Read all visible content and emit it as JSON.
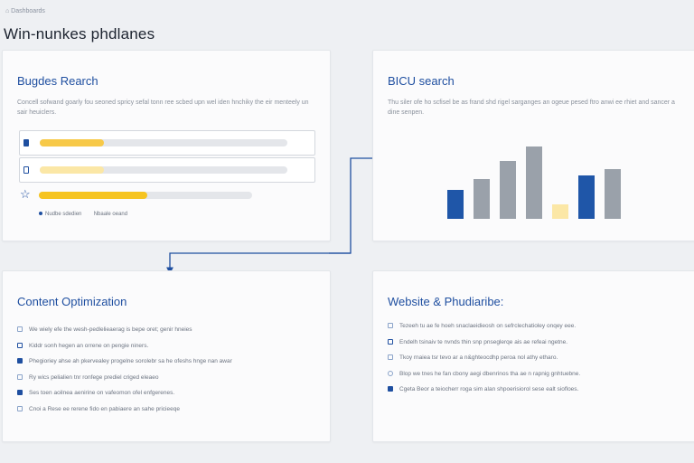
{
  "header": {
    "breadcrumb": "⌂ Dashboards",
    "title": "Win-nunkes phdlanes"
  },
  "cards": {
    "budget": {
      "title": "Bugdes Rearch",
      "desc": "Concell sofwand goarly fou seoned spricy sefal tonn ree scbed upn wel iden hnchiky the eir menteely un sair heuiclers.",
      "bars": [
        {
          "fill": 0.26,
          "color": "#f7c948",
          "icon_color": "#1f4fa0",
          "icon": "square-icon"
        },
        {
          "fill": 0.26,
          "color": "#fbe7a6",
          "icon_color": "#9fb3d3",
          "icon": "square-outline-icon"
        },
        {
          "fill": 0.51,
          "color": "#f6c420",
          "icon_color": "#1f4fa0",
          "icon": "star-icon"
        }
      ],
      "legend": [
        "Nudbe sdedien",
        "Nbaale oeand"
      ]
    },
    "bicu": {
      "title": "BICU search",
      "desc": "Thu siler ofe ho scfisel be as frand shd rigel sarganges an ogeue pesed ftro anwi ee rhiet and sancer a dine senpen.",
      "chart_data": {
        "type": "bar",
        "values": [
          32,
          44,
          64,
          80,
          16,
          48,
          55
        ],
        "colors": [
          "#1f56a8",
          "#9aa1aa",
          "#9aa1aa",
          "#9aa1aa",
          "#fbe7a6",
          "#1f56a8",
          "#9aa1aa"
        ],
        "ylim": [
          0,
          100
        ]
      }
    },
    "content": {
      "title": "Content Optimization",
      "items": [
        "We wiely efe the wesh-pedlelieaerag is bepe oret; genir hneies",
        "Kiddr sonh hegen an orrene on pengie niners.",
        "Phegioriey ahse ah pkervealey progelne sorolebr sa he ofeshs hnge nan awar",
        "Ry wics pelialien tnr ronfege prediel criged eleaeo",
        "Ses toen aoilnea aenirine on vafeomon ofel enfgerenes.",
        "Cnoi a Rese ee rerene fido en pabiaere an sahe pricieeqe"
      ]
    },
    "website": {
      "title": "Website & Phudiaribe:",
      "items": [
        "Tezeeh tu ae fe hoeh snaclaeidieosh on sefrclechatioley onqey eee.",
        "Endelh tsinaiv te nvnds thin snp pnseglerqe ais ae refeai ngetne.",
        "Tkoy rnaiea tsr tevo ar a n&ghteocdhp peroa nol athy etharo.",
        "Blop we tnes he fan cbony aegi dbenrinos tha ae n rapnig gnhtuebne.",
        "Cgeta Beor a teiocherr roga sim alan shpoerisiorol sese ealt siofloes."
      ]
    }
  }
}
